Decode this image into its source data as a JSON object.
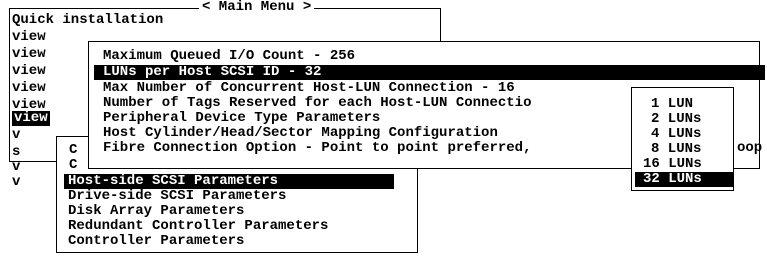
{
  "main_menu": {
    "title": "< Main Menu >",
    "items": [
      "Quick installation",
      "view",
      "view",
      "view",
      "view",
      "view",
      "view",
      "v",
      "s",
      "v",
      "v"
    ],
    "partial_c": [
      "C",
      "C"
    ]
  },
  "config_menu": {
    "items": [
      "Host-side SCSI Parameters",
      "Drive-side SCSI Parameters",
      "Disk Array Parameters",
      "Redundant Controller Parameters",
      "Controller Parameters"
    ],
    "selected_index": 0
  },
  "host_menu": {
    "items": [
      "Maximum Queued I/O Count - 256",
      "LUNs per Host SCSI ID - 32",
      "Max Number of Concurrent Host-LUN Connection - 16",
      "Number of Tags Reserved for each Host-LUN Connectio",
      "Peripheral Device Type Parameters",
      "Host Cylinder/Head/Sector Mapping Configuration",
      "Fibre Connection Option - Point to point preferred,"
    ],
    "selected_index": 1,
    "overflow_text": "oop"
  },
  "lun_menu": {
    "items": [
      "1 LUN",
      "2 LUNs",
      "4 LUNs",
      "8 LUNs",
      "16 LUNs",
      "32 LUNs"
    ],
    "selected_index": 5
  }
}
